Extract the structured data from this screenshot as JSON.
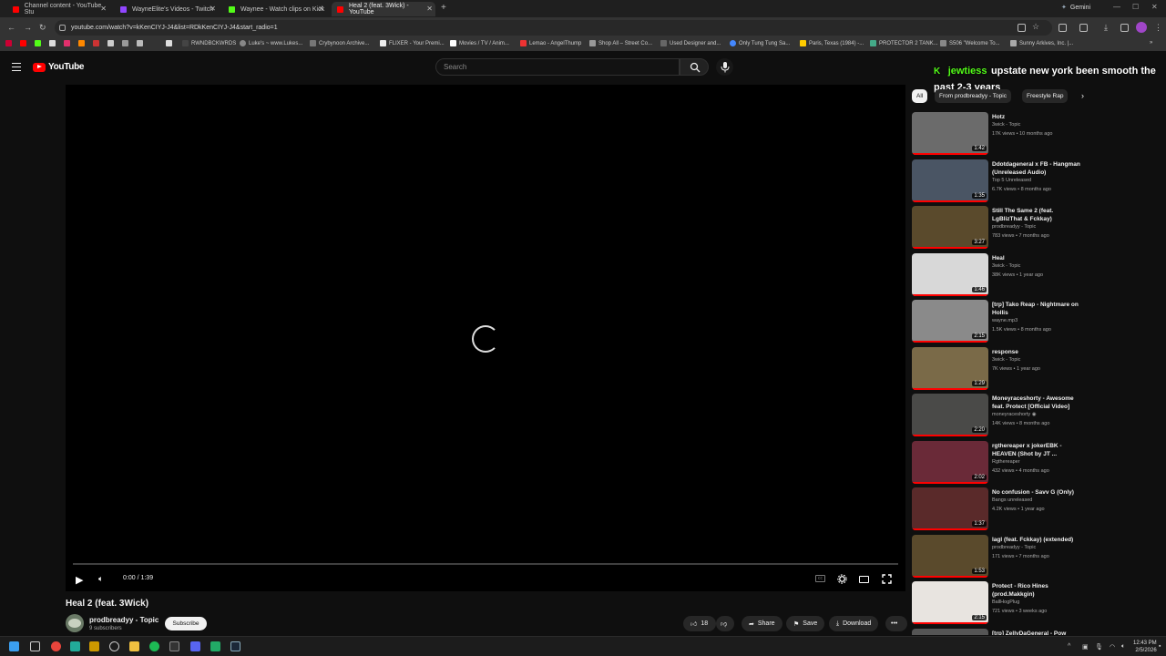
{
  "browser": {
    "tabs": [
      {
        "title": "Channel content - YouTube Stu",
        "color": "#ff0000"
      },
      {
        "title": "WayneElite's Videos - Twitch",
        "color": "#9146ff"
      },
      {
        "title": "Waynee - Watch clips on Kick",
        "color": "#53fc18"
      },
      {
        "title": "Heal 2 (feat. 3Wick) - YouTube",
        "color": "#ff0000"
      }
    ],
    "new_tab": "+",
    "profile_label": "Gemini",
    "url": "youtube.com/watch?v=kKenCIYJ-J4&list=RDkKenCIYJ-J4&start_radio=1",
    "bookmarks": [
      "RWNDBCKWRDS",
      "Luke's ~ www.Lukes...",
      "Crybynoon Archive...",
      "FLIXER - Your Premi...",
      "Movies / TV / Anim...",
      "Lemao - AngelThump",
      "Shop All – Street Co...",
      "Used Designer and...",
      "Only Tung Tung Sa...",
      "Paris, Texas (1984) -...",
      "PROTECTOR 2 TANK...",
      "S506 \"Welcome To...",
      "Sunny Arkives, Inc. |..."
    ]
  },
  "youtube": {
    "logo_text": "YouTube",
    "search_placeholder": "Search",
    "player": {
      "time": "0:00 / 1:39"
    },
    "video": {
      "title": "Heal 2 (feat. 3Wick)",
      "channel": "prodbreadyy - Topic",
      "subscribers": "9 subscribers",
      "subscribe_label": "Subscribe",
      "likes": "18",
      "share_label": "Share",
      "save_label": "Save",
      "download_label": "Download"
    },
    "overlay": {
      "platform": "K",
      "user": "jewtiess",
      "message": "upstate new york been smooth the past 2-3 years"
    },
    "chips": [
      "All",
      "From prodbreadyy - Topic",
      "Freestyle Rap"
    ],
    "recommendations": [
      {
        "title": "Hotz",
        "channel": "3wick - Topic",
        "meta": "17K views • 10 months ago",
        "duration": "1:42",
        "thumb": "#6b6b6b"
      },
      {
        "title": "Ddotdageneral x FB - Hangman (Unreleased Audio)",
        "channel": "Top 5 Unreleased",
        "meta": "6.7K views • 8 months ago",
        "duration": "1:35",
        "thumb": "#4a5564"
      },
      {
        "title": "Still The Same 2 (feat. LgBlizThat & Fckkay)",
        "channel": "prodbreadyy - Topic",
        "meta": "783 views • 7 months ago",
        "duration": "3:27",
        "thumb": "#5a4a2c"
      },
      {
        "title": "Heal",
        "channel": "3wick - Topic",
        "meta": "38K views • 1 year ago",
        "duration": "1:46",
        "thumb": "#d8d8d8"
      },
      {
        "title": "[trp] Tako Reap - Nightmare on Hollis",
        "channel": "wayne.mp3",
        "meta": "1.5K views • 8 months ago",
        "duration": "2:15",
        "thumb": "#8a8a8a"
      },
      {
        "title": "response",
        "channel": "3wick - Topic",
        "meta": "7K views • 1 year ago",
        "duration": "1:29",
        "thumb": "#7a6a48"
      },
      {
        "title": "Moneyraceshorty - Awesome feat. Protect [Official Video]",
        "channel": "moneyraceshorty ◉",
        "meta": "14K views • 8 months ago",
        "duration": "2:20",
        "thumb": "#4a4a48"
      },
      {
        "title": "rgthereaper x jokerEBK - HEAVEN (Shot by JT ...",
        "channel": "Rgthereaper",
        "meta": "432 views • 4 months ago",
        "duration": "2:02",
        "thumb": "#6a2a38"
      },
      {
        "title": "No confusion - Savv G (Only)",
        "channel": "Bangs unreleased",
        "meta": "4.2K views • 1 year ago",
        "duration": "1:37",
        "thumb": "#5a2a2a"
      },
      {
        "title": "lagl (feat. Fckkay) (extended)",
        "channel": "prodbreadyy - Topic",
        "meta": "171 views • 7 months ago",
        "duration": "1:53",
        "thumb": "#5a4a2c"
      },
      {
        "title": "Protect - Rico Hines (prod.Makkgin)",
        "channel": "BallHogPlug",
        "meta": "721 views • 3 weeks ago",
        "duration": "2:15",
        "thumb": "#e8e4e0"
      },
      {
        "title": "[trp] ZellyDaGeneral - Pow",
        "channel": "",
        "meta": "",
        "duration": "",
        "thumb": "#555"
      }
    ]
  },
  "taskbar": {
    "time": "12:43 PM",
    "date": "2/5/2026"
  }
}
